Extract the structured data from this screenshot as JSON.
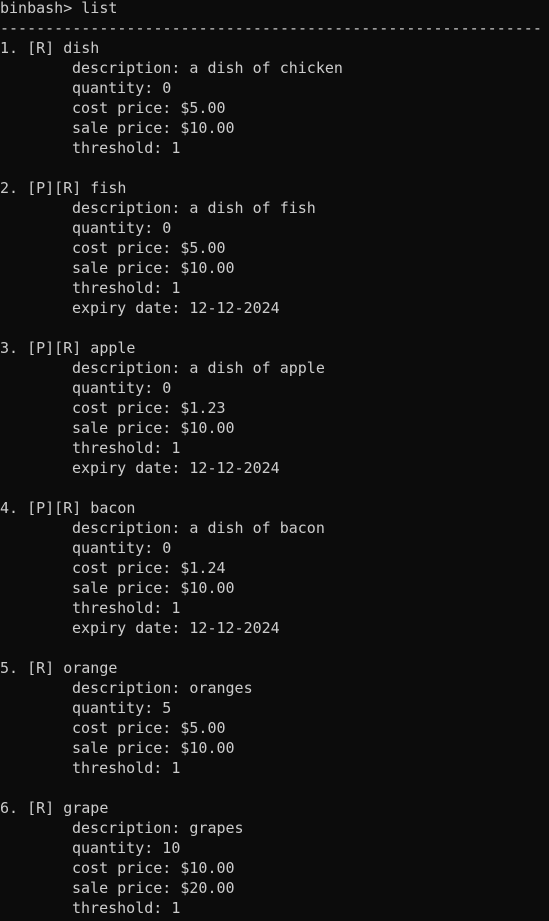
{
  "terminal": {
    "prompt": "binbash> list",
    "separator": "------------------------------------------------------------",
    "items": [
      {
        "header": "1. [R] dish",
        "fields": [
          "description: a dish of chicken",
          "quantity: 0",
          "cost price: $5.00",
          "sale price: $10.00",
          "threshold: 1"
        ]
      },
      {
        "header": "2. [P][R] fish",
        "fields": [
          "description: a dish of fish",
          "quantity: 0",
          "cost price: $5.00",
          "sale price: $10.00",
          "threshold: 1",
          "expiry date: 12-12-2024"
        ]
      },
      {
        "header": "3. [P][R] apple",
        "fields": [
          "description: a dish of apple",
          "quantity: 0",
          "cost price: $1.23",
          "sale price: $10.00",
          "threshold: 1",
          "expiry date: 12-12-2024"
        ]
      },
      {
        "header": "4. [P][R] bacon",
        "fields": [
          "description: a dish of bacon",
          "quantity: 0",
          "cost price: $1.24",
          "sale price: $10.00",
          "threshold: 1",
          "expiry date: 12-12-2024"
        ]
      },
      {
        "header": "5. [R] orange",
        "fields": [
          "description: oranges",
          "quantity: 5",
          "cost price: $5.00",
          "sale price: $10.00",
          "threshold: 1"
        ]
      },
      {
        "header": "6. [R] grape",
        "fields": [
          "description: grapes",
          "quantity: 10",
          "cost price: $10.00",
          "sale price: $20.00",
          "threshold: 1"
        ]
      }
    ]
  }
}
